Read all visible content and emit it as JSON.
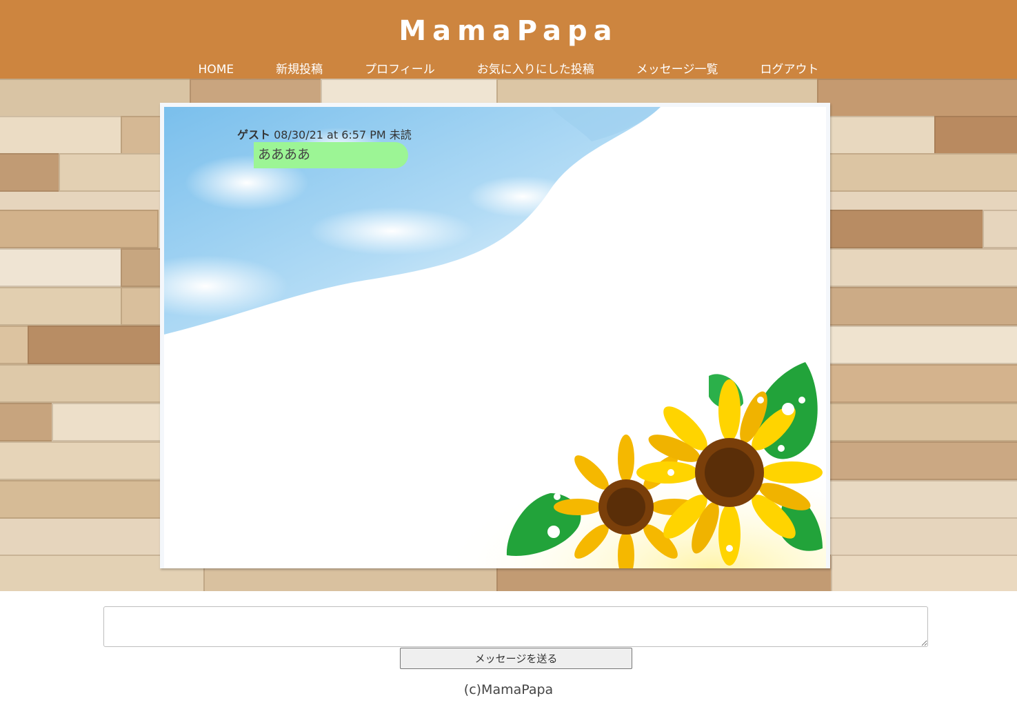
{
  "header": {
    "logo": "MamaPapa",
    "nav": [
      "HOME",
      "新規投稿",
      "プロフィール",
      "お気に入りにした投稿",
      "メッセージ一覧",
      "ログアウト"
    ]
  },
  "chat": {
    "messages": [
      {
        "sender": "ゲスト",
        "timestamp": "08/30/21 at 6:57 PM",
        "status": "未読",
        "text": "ああああ"
      }
    ]
  },
  "form": {
    "message_value": "",
    "send_label": "メッセージを送る"
  },
  "footer": {
    "copyright": "(c)MamaPapa"
  },
  "colors": {
    "header": "#cd853f",
    "bubble": "#9cf595"
  }
}
